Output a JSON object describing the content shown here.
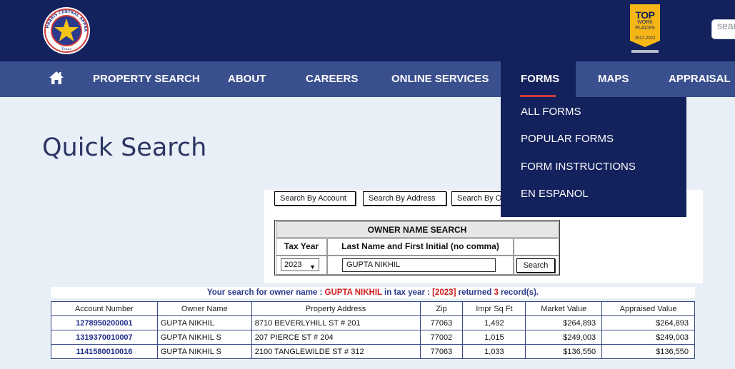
{
  "header": {
    "seal_text": "HARRIS CENTRAL APPRAISAL DISTRICT",
    "seal_state": "Texas",
    "badge": {
      "line1": "TOP",
      "line2": "WORK",
      "line3": "PLACES",
      "line4": "2017-2022",
      "footer": "HOUSTON CHRONICLE"
    },
    "search_placeholder": "sear"
  },
  "nav": {
    "home_icon": "home-icon",
    "items": [
      {
        "label": "PROPERTY SEARCH"
      },
      {
        "label": "ABOUT"
      },
      {
        "label": "CAREERS"
      },
      {
        "label": "ONLINE SERVICES"
      },
      {
        "label": "FORMS"
      },
      {
        "label": "MAPS"
      },
      {
        "label": "APPRAISAL"
      }
    ],
    "active": "FORMS"
  },
  "forms_menu": [
    {
      "label": "ALL FORMS"
    },
    {
      "label": "POPULAR FORMS"
    },
    {
      "label": "FORM INSTRUCTIONS"
    },
    {
      "label": "EN ESPANOL"
    }
  ],
  "page_title": "Quick Search",
  "search_tabs": [
    {
      "label": "Search By Account"
    },
    {
      "label": "Search By Address"
    },
    {
      "label": "Search By Owner"
    }
  ],
  "owner_search": {
    "heading": "OWNER NAME SEARCH",
    "col_tax_year": "Tax Year",
    "col_name": "Last Name and First Initial (no comma)",
    "tax_year_value": "2023",
    "name_value": "GUPTA NIKHIL",
    "search_label": "Search"
  },
  "result_message": {
    "prefix": "Your search for owner name : ",
    "name": "GUPTA NIKHIL",
    "mid": " in tax year : ",
    "year": "[2023]",
    "returned": " returned ",
    "count": "3",
    "suffix": " record(s)."
  },
  "results": {
    "columns": [
      "Account Number",
      "Owner Name",
      "Property Address",
      "Zip",
      "Impr Sq Ft",
      "Market Value",
      "Appraised Value"
    ],
    "rows": [
      [
        "1278950200001",
        "GUPTA NIKHIL",
        "8710 BEVERLYHILL ST # 201",
        "77063",
        "1,492",
        "$264,893",
        "$264,893"
      ],
      [
        "1319370010007",
        "GUPTA NIKHIL S",
        "207 PIERCE ST # 204",
        "77002",
        "1,015",
        "$249,003",
        "$249,003"
      ],
      [
        "1141580010016",
        "GUPTA NIKHIL S",
        "2100 TANGLEWILDE ST # 312",
        "77063",
        "1,033",
        "$136,550",
        "$136,550"
      ]
    ]
  },
  "colors": {
    "header_bg": "#13215c",
    "nav_bg": "#3a4f8e",
    "page_bg": "#e8eff7",
    "accent_red": "#d13b3b",
    "badge_gold": "#f6b616"
  }
}
